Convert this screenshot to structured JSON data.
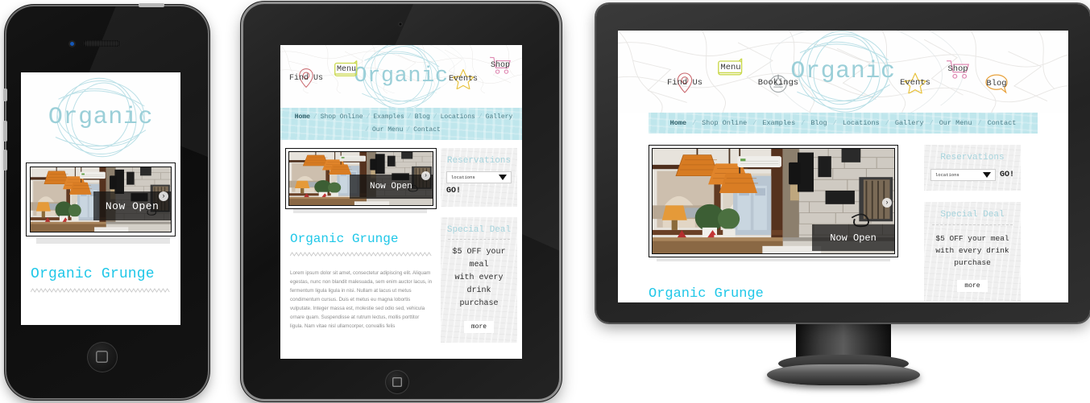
{
  "brand": {
    "logo_text": "Organic",
    "logo_color": "#9bcfd8",
    "heading_color": "#1fc7e8",
    "nav_bg": "#bfe6ec",
    "widget_title_color": "#a6d3dc"
  },
  "header_icons_desktop": [
    {
      "label": "Find Us",
      "icon": "map-pin-icon",
      "color": "#c9666c"
    },
    {
      "label": "Menu",
      "icon": "menu-book-icon",
      "color": "#c9d84a"
    },
    {
      "label": "Bookings",
      "icon": "telephone-icon",
      "color": "#9aa0a2"
    },
    {
      "label": "Events",
      "icon": "star-icon",
      "color": "#e8c23c"
    },
    {
      "label": "Shop",
      "icon": "shopping-cart-icon",
      "color": "#e08ab4"
    },
    {
      "label": "Blog",
      "icon": "speech-bubble-icon",
      "color": "#e8a23c"
    }
  ],
  "header_icons_tablet": [
    {
      "label": "Find Us",
      "icon": "map-pin-icon",
      "color": "#c9666c"
    },
    {
      "label": "Menu",
      "icon": "menu-book-icon",
      "color": "#c9d84a"
    },
    {
      "label": "Events",
      "icon": "star-icon",
      "color": "#e8c23c"
    },
    {
      "label": "Shop",
      "icon": "shopping-cart-icon",
      "color": "#e08ab4"
    }
  ],
  "nav": {
    "items": [
      "Home",
      "Shop Online",
      "Examples",
      "Blog",
      "Locations",
      "Gallery",
      "Our Menu",
      "Contact"
    ],
    "active": "Home",
    "separator": "/",
    "tablet_row1": [
      "Home",
      "Shop Online",
      "Examples",
      "Blog",
      "Locations",
      "Gallery"
    ],
    "tablet_row2": [
      "Our Menu",
      "Contact"
    ]
  },
  "hero": {
    "caption": "Now Open",
    "next_arrow": "›",
    "alt": "cafe interior with woven pendant lamps and stone wall"
  },
  "reservations": {
    "title": "Reservations",
    "select_value": "locations",
    "select_options": [
      "locations"
    ],
    "go_label": "GO!"
  },
  "special_deal": {
    "title": "Special Deal",
    "line_desktop_1": "$5 OFF your meal",
    "line_desktop_2": "with every drink",
    "line_desktop_3": "purchase",
    "line_tablet_1": "$5 OFF your",
    "line_tablet_2": "meal",
    "line_tablet_3": "with every",
    "line_tablet_4": "drink",
    "line_tablet_5": "purchase",
    "more_label": "more"
  },
  "article": {
    "heading": "Organic Grunge",
    "body": "Lorem ipsum dolor sit amet, consectetur adipiscing elit. Aliquam egestas, nunc non blandit malesuada, sem enim auctor lacus, in fermentum ligula ligula in nisi. Nullam at lacus ut metus condimentum cursus. Duis et metus eu magna lobortis vulputate. Integer massa est, molestie sed odio sed, vehicula ornare quam. Suspendisse at rutrum lectus, mollis porttitor ligula. Nam vitae nisl ullamcorper, convallis felis"
  },
  "devices": {
    "phone": "phone-mockup",
    "tablet": "tablet-mockup",
    "desktop": "desktop-monitor-mockup"
  }
}
